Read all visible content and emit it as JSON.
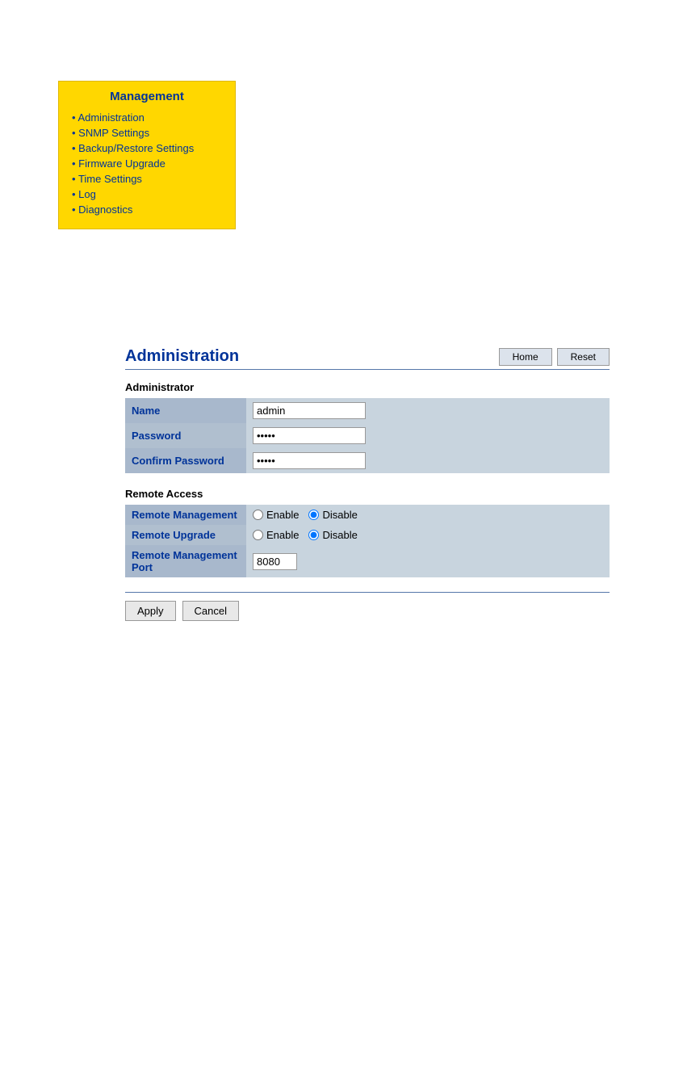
{
  "nav": {
    "title": "Management",
    "items": [
      "Administration",
      "SNMP Settings",
      "Backup/Restore Settings",
      "Firmware Upgrade",
      "Time Settings",
      "Log",
      "Diagnostics"
    ]
  },
  "page": {
    "title": "Administration",
    "home_button": "Home",
    "reset_button": "Reset"
  },
  "administrator": {
    "section_label": "Administrator",
    "name_label": "Name",
    "name_value": "admin",
    "password_label": "Password",
    "password_value": "•••••",
    "confirm_password_label": "Confirm Password",
    "confirm_password_value": "•••••"
  },
  "remote_access": {
    "section_label": "Remote Access",
    "remote_management_label": "Remote Management",
    "remote_upgrade_label": "Remote Upgrade",
    "remote_management_port_label": "Remote Management Port",
    "remote_management_port_value": "8080",
    "enable_label": "Enable",
    "disable_label": "Disable"
  },
  "buttons": {
    "apply_label": "Apply",
    "cancel_label": "Cancel"
  }
}
